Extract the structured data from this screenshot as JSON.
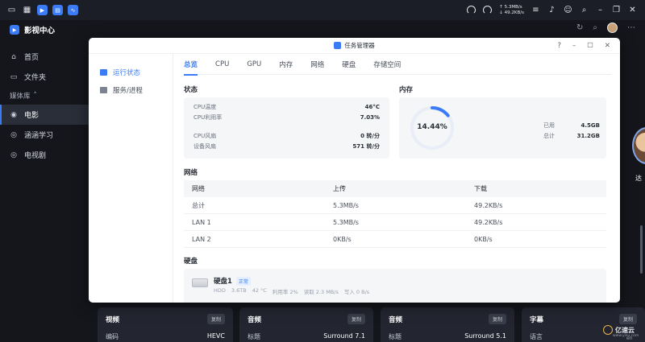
{
  "os": {
    "upload_speed": "5.3MB/s",
    "download_speed": "49.2KB/s"
  },
  "app": {
    "title": "影视中心",
    "nav": [
      {
        "label": "首页",
        "icon": "home-icon"
      },
      {
        "label": "文件夹",
        "icon": "folder-icon"
      }
    ],
    "section": "媒体库",
    "library": [
      {
        "label": "电影",
        "icon": "film-icon",
        "active": true
      },
      {
        "label": "涵涵学习",
        "icon": "reel-icon"
      },
      {
        "label": "电视剧",
        "icon": "tv-icon"
      }
    ],
    "peek_text": "达"
  },
  "cards": [
    {
      "title": "视频",
      "copy": "复制",
      "key": "编码",
      "value": "HEVC"
    },
    {
      "title": "音频",
      "copy": "复制",
      "key": "标题",
      "value": "Surround 7.1"
    },
    {
      "title": "音频",
      "copy": "复制",
      "key": "标题",
      "value": "Surround 5.1"
    },
    {
      "title": "字幕",
      "copy": "复制",
      "key": "语言",
      "value": ""
    }
  ],
  "watermark": {
    "name": "亿速云",
    "sub": "www.yisu.com",
    "lang": "en"
  },
  "window": {
    "title": "任务管理器",
    "left_menu": [
      {
        "label": "运行状态",
        "active": true
      },
      {
        "label": "服务/进程",
        "active": false
      }
    ],
    "tabs": [
      "总览",
      "CPU",
      "GPU",
      "内存",
      "网络",
      "硬盘",
      "存储空间"
    ],
    "status": {
      "title": "状态",
      "rows": [
        {
          "label": "CPU温度",
          "value": "46°C"
        },
        {
          "label": "CPU利用率",
          "value": "7.03%"
        },
        {
          "label": "CPU风扇",
          "value": "0 转/分"
        },
        {
          "label": "设备风扇",
          "value": "571 转/分"
        }
      ]
    },
    "memory": {
      "title": "内存",
      "percent_label": "14.44%",
      "percent": 0.1444,
      "used_label": "已用",
      "used": "4.5GB",
      "total_label": "总计",
      "total": "31.2GB"
    },
    "network": {
      "title": "网络",
      "headers": [
        "网络",
        "上传",
        "下载"
      ],
      "rows": [
        [
          "总计",
          "5.3MB/s",
          "49.2KB/s"
        ],
        [
          "LAN 1",
          "5.3MB/s",
          "49.2KB/s"
        ],
        [
          "LAN 2",
          "0KB/s",
          "0KB/s"
        ]
      ]
    },
    "disk": {
      "title": "硬盘",
      "name": "硬盘1",
      "status": "正常",
      "type": "HDD",
      "capacity": "3.6TB",
      "temp": "42 °C",
      "usage": "利用率 2%",
      "read": "读取 2.3 MB/s",
      "write": "写入 0 B/s"
    }
  },
  "colors": {
    "accent": "#3b7cf6",
    "ok_badge": "#e6efff"
  }
}
